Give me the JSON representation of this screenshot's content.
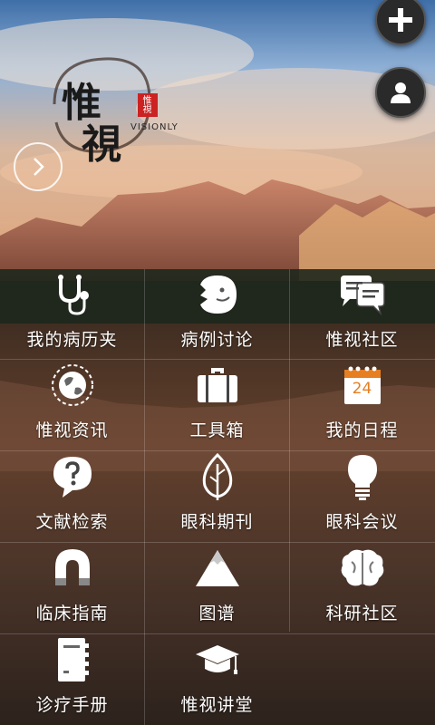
{
  "app": {
    "logo_cn_1": "惟",
    "logo_cn_2": "視",
    "logo_en": "VISIONLY",
    "seal_text": "惟視"
  },
  "fab": {
    "add_icon": "plus-icon",
    "user_icon": "user-icon"
  },
  "menu": [
    {
      "label": "我的病历夹",
      "icon": "stethoscope-icon"
    },
    {
      "label": "病例讨论",
      "icon": "face-icon"
    },
    {
      "label": "惟视社区",
      "icon": "chat-bubbles-icon"
    },
    {
      "label": "惟视资讯",
      "icon": "globe-icon"
    },
    {
      "label": "工具箱",
      "icon": "toolbox-icon"
    },
    {
      "label": "我的日程",
      "icon": "calendar-icon",
      "badge": "24"
    },
    {
      "label": "文献检索",
      "icon": "question-bubble-icon"
    },
    {
      "label": "眼科期刊",
      "icon": "leaf-icon"
    },
    {
      "label": "眼科会议",
      "icon": "lightbulb-icon"
    },
    {
      "label": "临床指南",
      "icon": "magnet-icon"
    },
    {
      "label": "图谱",
      "icon": "mountain-icon"
    },
    {
      "label": "科研社区",
      "icon": "brain-icon"
    },
    {
      "label": "诊疗手册",
      "icon": "notebook-icon"
    },
    {
      "label": "惟视讲堂",
      "icon": "graduation-cap-icon"
    }
  ]
}
